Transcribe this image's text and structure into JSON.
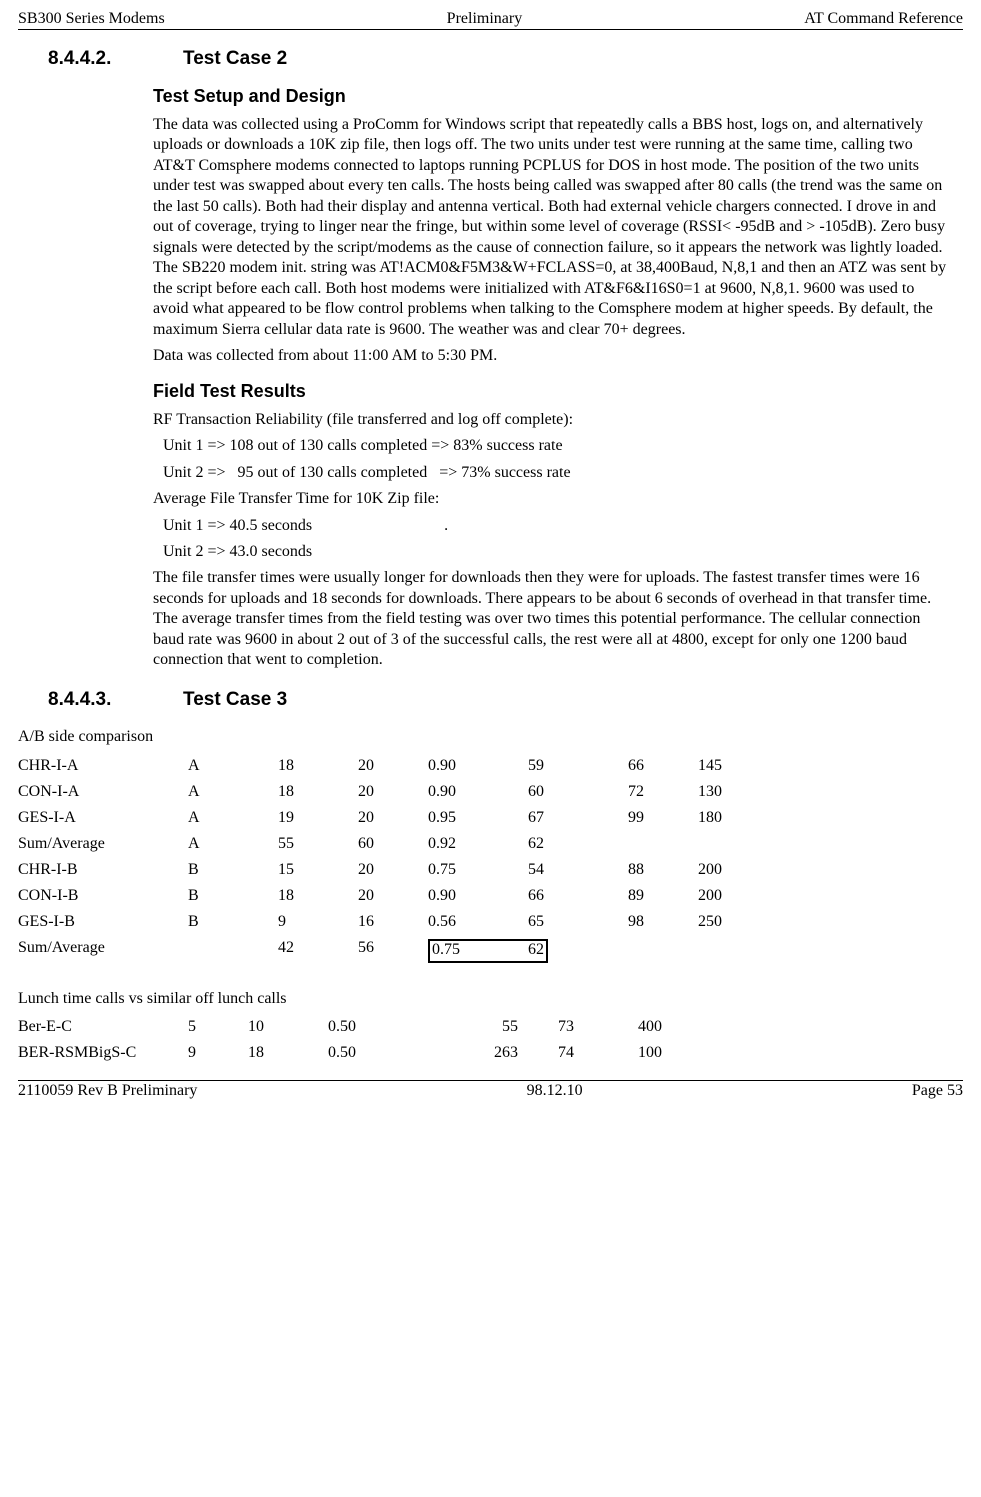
{
  "header": {
    "left": "SB300 Series Modems",
    "center": "Preliminary",
    "right": "AT Command Reference"
  },
  "footer": {
    "left": "2110059 Rev B Preliminary",
    "center": "98.12.10",
    "right": "Page 53"
  },
  "sec1": {
    "num": "8.4.4.2.",
    "title": "Test Case 2"
  },
  "setup_h": "Test Setup and Design",
  "setup_p": "The data was collected using a ProComm for Windows script that repeatedly calls a BBS host, logs on, and alternatively uploads or downloads a 10K zip file, then logs off. The two units under test were running at the same time, calling two AT&T Comsphere modems connected to laptops running PCPLUS for DOS in host mode. The position of the two units under test was swapped about every ten calls. The hosts being called was swapped after 80 calls (the trend was the same on the last 50 calls). Both had their display and antenna vertical. Both had external vehicle chargers connected.  I drove in and out of coverage, trying to linger near the fringe, but within some level of coverage (RSSI< -95dB and  > -105dB). Zero busy signals were detected by the script/modems as the cause of connection failure, so it appears the network was lightly loaded. The SB220 modem init. string was AT!ACM0&F5M3&W+FCLASS=0, at 38,400Baud, N,8,1 and then an ATZ was sent by the script before each call. Both host modems were initialized with AT&F6&I16S0=1 at 9600, N,8,1. 9600 was used  to avoid what appeared to be flow control problems when talking to the Comsphere modem at higher speeds. By default, the maximum Sierra cellular data rate is 9600. The weather was and clear 70+ degrees.",
  "setup_p2": "Data was collected from about 11:00 AM to 5:30 PM.",
  "results_h": "Field Test Results",
  "r1": "RF Transaction Reliability (file transferred and log off complete):",
  "r2": "Unit 1 => 108 out of 130 calls completed => 83% success rate",
  "r3": "Unit 2 =>   95 out of 130 calls completed   => 73% success rate",
  "r4": "Average File Transfer Time for 10K Zip file:",
  "r5": "Unit 1 => 40.5 seconds                                 .",
  "r6": "Unit 2 => 43.0 seconds",
  "r7": "The file transfer times were usually longer for downloads then they were for uploads. The fastest transfer times were 16 seconds for uploads and 18 seconds for downloads. There appears to be about 6 seconds of overhead in that transfer time. The average transfer times from the field testing was over two times this potential performance. The cellular connection baud rate was 9600 in about 2 out of 3 of the successful calls, the rest were all at 4800, except for only one 1200 baud connection that went to completion.",
  "sec2": {
    "num": "8.4.4.3.",
    "title": "Test Case 3"
  },
  "ab_caption": "A/B side comparison",
  "table1": [
    [
      "CHR-I-A",
      "A",
      "18",
      "20",
      "0.90",
      "59",
      "66",
      "145"
    ],
    [
      "CON-I-A",
      "A",
      "18",
      "20",
      "0.90",
      "60",
      "72",
      "130"
    ],
    [
      "GES-I-A",
      "A",
      "19",
      "20",
      "0.95",
      "67",
      "99",
      "180"
    ],
    [
      "Sum/Average",
      "A",
      "55",
      "60",
      "0.92",
      "62",
      "",
      ""
    ],
    [
      "CHR-I-B",
      "B",
      "15",
      "20",
      "0.75",
      "54",
      "88",
      "200"
    ],
    [
      "CON-I-B",
      "B",
      "18",
      "20",
      "0.90",
      "66",
      "89",
      "200"
    ],
    [
      "GES-I-B",
      "B",
      "9",
      "16",
      "0.56",
      "65",
      "98",
      "250"
    ],
    [
      "Sum/Average",
      "",
      "42",
      "56",
      "0.75",
      "62",
      "",
      ""
    ]
  ],
  "lunch_caption": "Lunch time calls vs similar off lunch calls",
  "table2": [
    [
      "Ber-E-C",
      "5",
      "10",
      "0.50",
      "55",
      "73",
      "400"
    ],
    [
      "BER-RSMBigS-C",
      "9",
      "18",
      "0.50",
      "263",
      "74",
      "100"
    ]
  ]
}
